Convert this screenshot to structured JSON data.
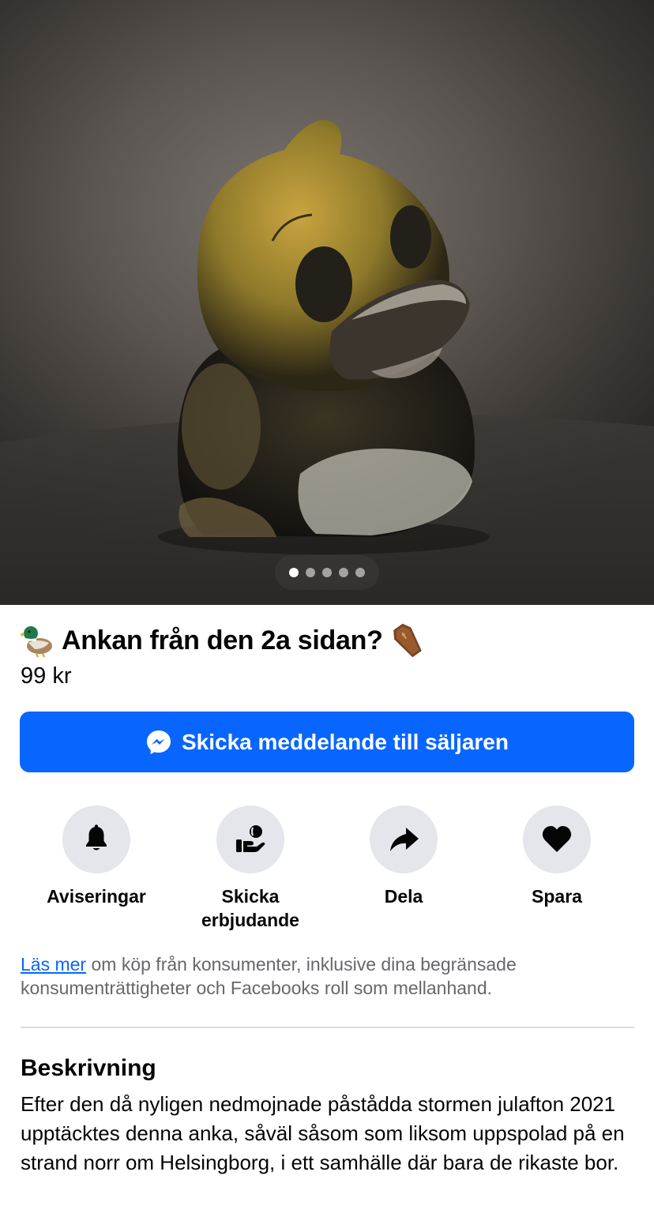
{
  "listing": {
    "title": "Ankan från den 2a sidan?",
    "title_prefix_emoji": "duck-emoji",
    "title_suffix_emoji": "coffin-emoji",
    "price": "99 kr"
  },
  "gallery": {
    "total_images": 5,
    "active_index": 0
  },
  "message_button": {
    "label": "Skicka meddelande till säljaren",
    "icon": "messenger-icon",
    "color": "#0866ff"
  },
  "actions": [
    {
      "label": "Aviseringar",
      "icon": "bell-icon"
    },
    {
      "label": "Skicka erbjudande",
      "icon": "offer-hand-icon"
    },
    {
      "label": "Dela",
      "icon": "share-arrow-icon"
    },
    {
      "label": "Spara",
      "icon": "heart-icon"
    }
  ],
  "info": {
    "link_text": "Läs mer",
    "text": " om köp från konsumenter, inklusive dina begränsade konsumenträttigheter och Facebooks roll som mellanhand."
  },
  "description": {
    "heading": "Beskrivning",
    "body": "Efter den då nyligen nedmojnade påstådda stormen julafton 2021 upptäcktes denna anka, såväl såsom som liksom uppspolad på en strand norr om Helsingborg, i ett samhälle där bara de rikaste bor."
  }
}
